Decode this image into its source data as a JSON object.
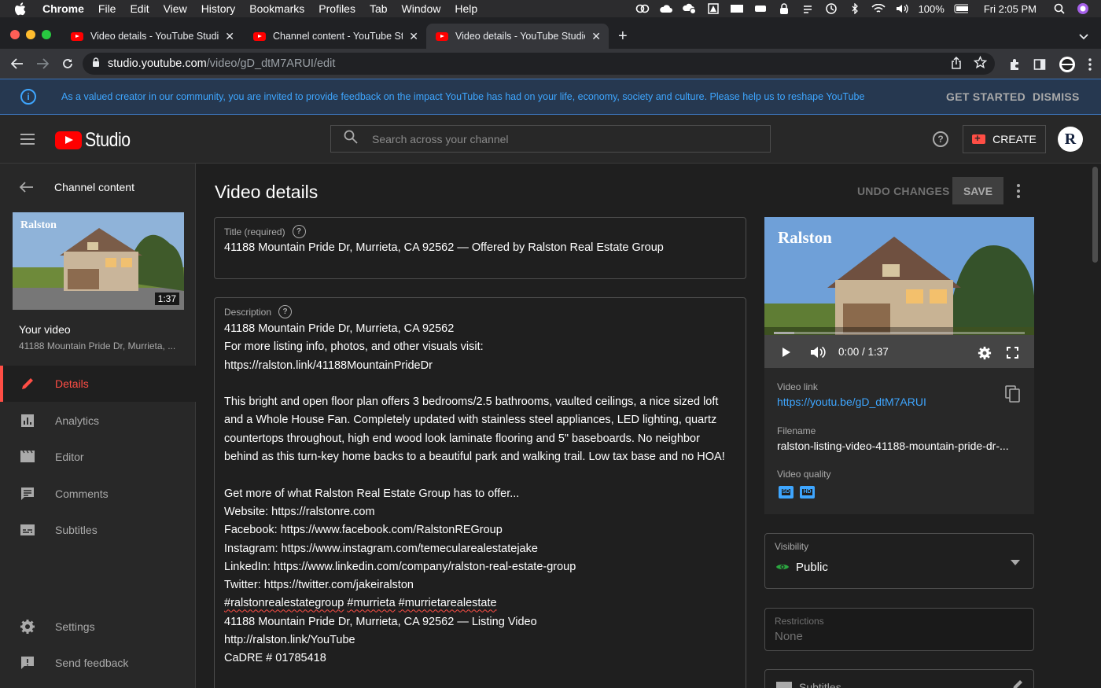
{
  "menubar": {
    "app": "Chrome",
    "items": [
      "File",
      "Edit",
      "View",
      "History",
      "Bookmarks",
      "Profiles",
      "Tab",
      "Window",
      "Help"
    ],
    "battery": "100%",
    "clock": "Fri 2:05 PM"
  },
  "tabs": [
    {
      "label": "Video details - YouTube Studio"
    },
    {
      "label": "Channel content - YouTube Stu"
    },
    {
      "label": "Video details - YouTube Studio"
    }
  ],
  "address": {
    "host": "studio.youtube.com",
    "path": "/video/gD_dtM7ARUI/edit"
  },
  "banner": {
    "message": "As a valued creator in our community, you are invited to provide feedback on the impact YouTube has had on your life, economy, society and culture. Please help us to reshape YouTube",
    "get_started": "GET STARTED",
    "dismiss": "DISMISS"
  },
  "header": {
    "logo": "Studio",
    "search_placeholder": "Search across your channel",
    "create": "CREATE",
    "avatar_initial": "R"
  },
  "sidebar": {
    "back_label": "Channel content",
    "thumb_duration": "1:37",
    "your_video": "Your video",
    "video_subtitle": "41188 Mountain Pride Dr, Murrieta, ...",
    "nav": [
      {
        "label": "Details"
      },
      {
        "label": "Analytics"
      },
      {
        "label": "Editor"
      },
      {
        "label": "Comments"
      },
      {
        "label": "Subtitles"
      },
      {
        "label": "Settings"
      },
      {
        "label": "Send feedback"
      }
    ]
  },
  "main": {
    "title": "Video details",
    "undo": "UNDO CHANGES",
    "save": "SAVE",
    "title_field": {
      "label": "Title (required)",
      "value": "41188 Mountain Pride Dr, Murrieta, CA 92562 — Offered by Ralston Real Estate Group"
    },
    "description_field": {
      "label": "Description",
      "lines_a": "41188 Mountain Pride Dr, Murrieta, CA 92562\nFor more listing info, photos, and other visuals visit:\nhttps://ralston.link/41188MountainPrideDr\n\nThis bright and open floor plan offers 3 bedrooms/2.5 bathrooms, vaulted ceilings, a nice sized loft\nand a Whole House Fan. Completely updated with stainless steel appliances, LED lighting, quartz\ncountertops throughout, high end wood look laminate flooring and 5\" baseboards. No neighbor\nbehind as this turn-key home backs to a beautiful park and walking trail. Low tax base and no HOA!\n\nGet more of what Ralston Real Estate Group has to offer...\nWebsite: https://ralstonre.com\nFacebook: https://www.facebook.com/RalstonREGroup\nInstagram: https://www.instagram.com/temecularealestatejake\nLinkedIn: https://www.linkedin.com/company/ralston-real-estate-group\nTwitter: https://twitter.com/jakeiralston\n",
      "hashtag1": "#ralstonrealestategroup",
      "hashtag2": "#murrieta",
      "hashtag3": "#murrietarealestate",
      "lines_b": "41188 Mountain Pride Dr, Murrieta, CA 92562 — Listing Video\nhttp://ralston.link/YouTube\nCaDRE # 01785418"
    },
    "player": {
      "brand": "Ralston",
      "time": "0:00 / 1:37",
      "progress": 0.0
    },
    "video_link_label": "Video link",
    "video_link": "https://youtu.be/gD_dtM7ARUI",
    "filename_label": "Filename",
    "filename": "ralston-listing-video-41188-mountain-pride-dr-...",
    "quality_label": "Video quality",
    "quality": [
      "SD",
      "HD"
    ],
    "visibility_label": "Visibility",
    "visibility": "Public",
    "restrictions_label": "Restrictions",
    "restrictions": "None",
    "subtitles_label": "Subtitles"
  },
  "colors": {
    "accent_red": "#ff4e45",
    "link_blue": "#3ea6ff",
    "bg": "#1f1f1f",
    "panel": "#282828",
    "public_green": "#2ba640"
  }
}
